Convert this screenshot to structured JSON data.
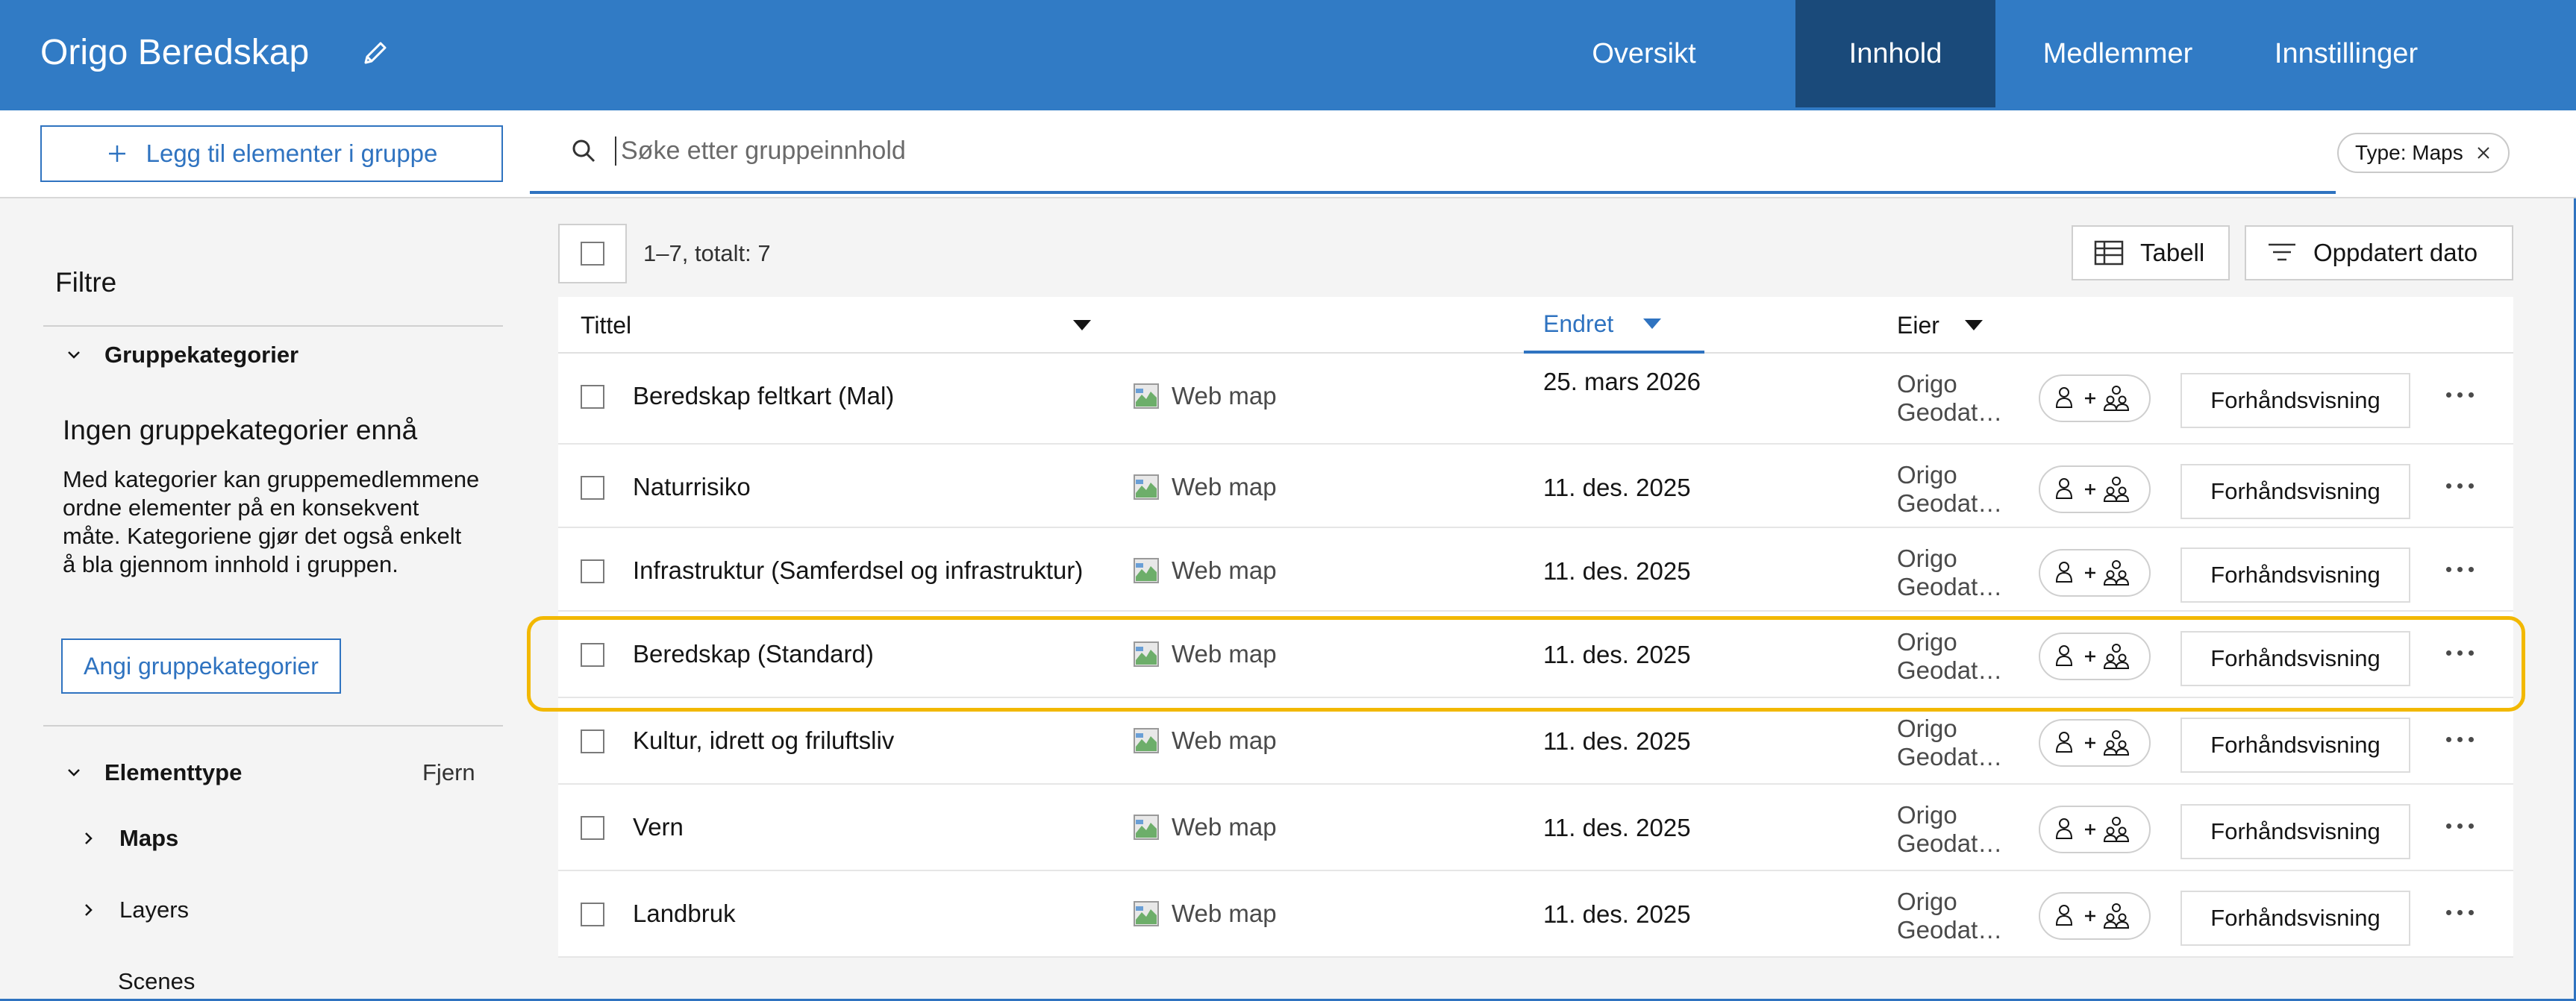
{
  "header": {
    "title": "Origo Beredskap",
    "tabs": [
      {
        "label": "Oversikt",
        "active": false
      },
      {
        "label": "Innhold",
        "active": true
      },
      {
        "label": "Medlemmer",
        "active": false
      },
      {
        "label": "Innstillinger",
        "active": false
      }
    ]
  },
  "toolbar": {
    "add_label": "Legg til elementer i gruppe",
    "search_placeholder": "Søke etter gruppeinnhold",
    "filter_chip": "Type: Maps"
  },
  "sidebar": {
    "filters_title": "Filtre",
    "category_section": "Gruppekategorier",
    "no_categories_title": "Ingen gruppekategorier ennå",
    "no_categories_desc": "Med kategorier kan gruppemedlemmene ordne elementer på en konsekvent måte. Kategoriene gjør det også enkelt å bla gjennom innhold i gruppen.",
    "set_categories_button": "Angi gruppekategorier",
    "element_type_section": "Elementtype",
    "remove_label": "Fjern",
    "types": [
      "Maps",
      "Layers",
      "Scenes"
    ]
  },
  "list": {
    "count_label": "1–7, totalt: 7",
    "view_button": "Tabell",
    "sort_button": "Oppdatert dato",
    "columns": {
      "title": "Tittel",
      "modified": "Endret",
      "owner": "Eier"
    },
    "preview_label": "Forhåndsvisning",
    "rows": [
      {
        "title": "Beredskap feltkart (Mal)",
        "type": "Web map",
        "date": "25. mars 2026",
        "owner_line1": "Origo",
        "owner_line2": "Geodat…"
      },
      {
        "title": "Naturrisiko",
        "type": "Web map",
        "date": "11. des. 2025",
        "owner_line1": "Origo",
        "owner_line2": "Geodat…"
      },
      {
        "title": "Infrastruktur (Samferdsel og infrastruktur)",
        "type": "Web map",
        "date": "11. des. 2025",
        "owner_line1": "Origo",
        "owner_line2": "Geodat…"
      },
      {
        "title": "Beredskap (Standard)",
        "type": "Web map",
        "date": "11. des. 2025",
        "owner_line1": "Origo",
        "owner_line2": "Geodat…"
      },
      {
        "title": "Kultur, idrett og friluftsliv",
        "type": "Web map",
        "date": "11. des. 2025",
        "owner_line1": "Origo",
        "owner_line2": "Geodat…"
      },
      {
        "title": "Vern",
        "type": "Web map",
        "date": "11. des. 2025",
        "owner_line1": "Origo",
        "owner_line2": "Geodat…"
      },
      {
        "title": "Landbruk",
        "type": "Web map",
        "date": "11. des. 2025",
        "owner_line1": "Origo",
        "owner_line2": "Geodat…"
      }
    ]
  },
  "colors": {
    "brand": "#317bc5",
    "active_tab": "#1a4a7a",
    "highlight": "#f2b800"
  }
}
